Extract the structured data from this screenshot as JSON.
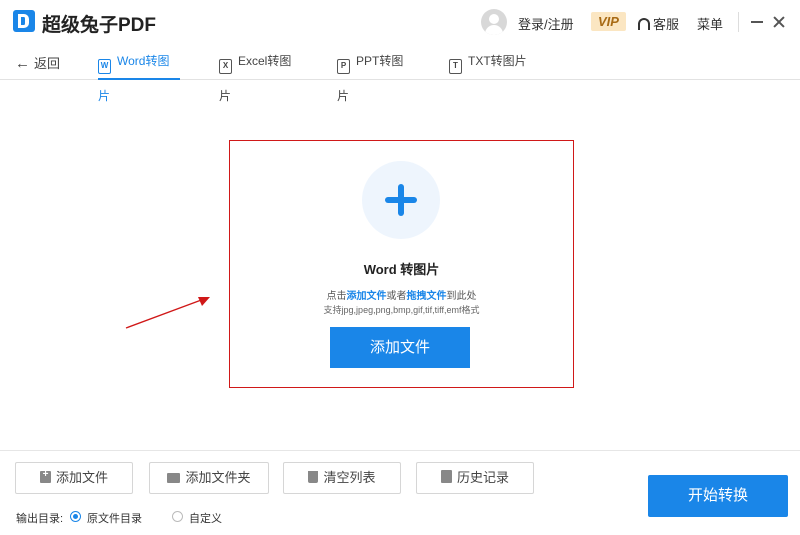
{
  "app": {
    "title": "超级兔子PDF"
  },
  "header": {
    "login_label": "登录/注册",
    "vip_label": "VIP",
    "service_label": "客服",
    "menu_label": "菜单"
  },
  "tabs": {
    "back_label": "返回",
    "items": [
      {
        "label": "Word转图片",
        "icon": "W",
        "active": true
      },
      {
        "label": "Excel转图片",
        "icon": "X",
        "active": false
      },
      {
        "label": "PPT转图片",
        "icon": "P",
        "active": false
      },
      {
        "label": "TXT转图片",
        "icon": "T",
        "active": false
      }
    ]
  },
  "dropzone": {
    "title": "Word 转图片",
    "hint_prefix": "点击",
    "hint_add": "添加文件",
    "hint_mid": "或者",
    "hint_drag": "拖拽文件",
    "hint_suffix": "到此处",
    "formats": "支持jpg,jpeg,png,bmp,gif,tif,tiff,emf格式",
    "add_button": "添加文件"
  },
  "toolbar": {
    "add_file": "添加文件",
    "add_folder": "添加文件夹",
    "clear_list": "清空列表",
    "history": "历史记录",
    "start": "开始转换"
  },
  "output": {
    "label": "输出目录:",
    "option_original": "原文件目录",
    "option_custom": "自定义",
    "selected": "原文件目录"
  },
  "colors": {
    "accent": "#1a86e8",
    "annotation": "#d01818",
    "vip_bg": "#fbe6c2"
  }
}
